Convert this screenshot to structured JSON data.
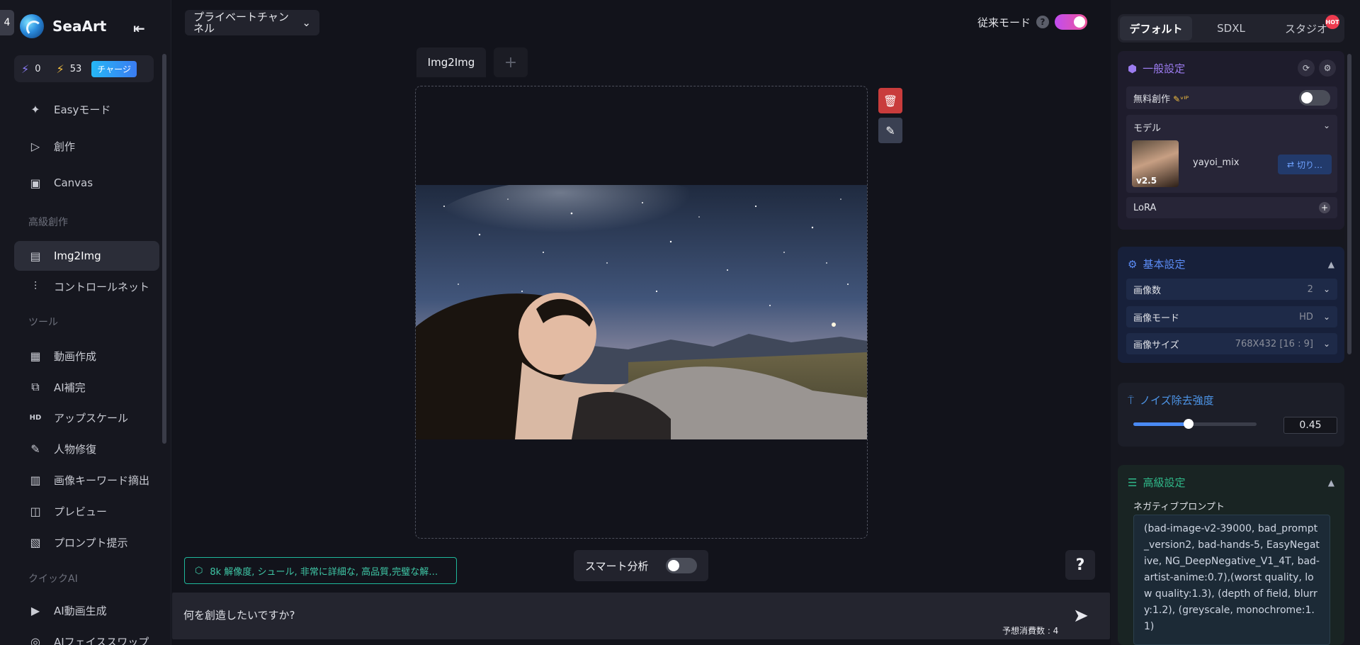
{
  "corner_badge": "4",
  "sidebar": {
    "app_name": "SeaArt",
    "credits": {
      "stamina": "0",
      "power": "53",
      "charge_label": "チャージ"
    },
    "items": [
      {
        "label": "Easyモード",
        "icon": "sparkle-icon"
      },
      {
        "label": "創作",
        "icon": "play-icon"
      },
      {
        "label": "Canvas",
        "icon": "canvas-icon"
      }
    ],
    "section_advanced": "高級創作",
    "advanced_items": [
      {
        "label": "Img2Img",
        "icon": "image-icon",
        "active": true
      },
      {
        "label": "コントロールネット",
        "icon": "sliders-icon"
      }
    ],
    "section_tools": "ツール",
    "tool_items": [
      {
        "label": "動画作成",
        "icon": "gif-icon"
      },
      {
        "label": "AI補完",
        "icon": "expand-icon"
      },
      {
        "label": "アップスケール",
        "icon": "hd-icon"
      },
      {
        "label": "人物修復",
        "icon": "repair-icon"
      },
      {
        "label": "画像キーワード摘出",
        "icon": "book-icon"
      },
      {
        "label": "プレビュー",
        "icon": "preview-icon"
      },
      {
        "label": "プロンプト提示",
        "icon": "prompt-icon"
      }
    ],
    "section_quick": "クイックAI",
    "quick_items": [
      {
        "label": "AI動画生成",
        "icon": "video-icon"
      },
      {
        "label": "AIフェイススワップ",
        "icon": "face-icon"
      }
    ]
  },
  "topbar": {
    "channel_label": "プライベートチャンネル",
    "legacy_mode_label": "従来モード",
    "legacy_mode_on": true
  },
  "workspace": {
    "tab_label": "Img2Img",
    "prompt_chip": "8k 解像度, シュール, 非常に詳細な, 高品質,完璧な解…",
    "smart_analysis_label": "スマート分析",
    "help_label": "?",
    "input_placeholder": "何を創造したいですか?",
    "cost_label": "予想消費数 : 4"
  },
  "right_panel": {
    "tabs": [
      {
        "label": "デフォルト",
        "active": true
      },
      {
        "label": "SDXL"
      },
      {
        "label": "スタジオ",
        "badge": "HOT"
      }
    ],
    "general": {
      "title": "一般設定",
      "free_create_label": "無料創作",
      "model_label": "モデル",
      "model_name": "yayoi_mix",
      "model_version": "v2.5",
      "switch_label": "切り…",
      "lora_label": "LoRA"
    },
    "basic": {
      "title": "基本設定",
      "image_count_label": "画像数",
      "image_count_value": "2",
      "image_mode_label": "画像モード",
      "image_mode_value": "HD",
      "image_size_label": "画像サイズ",
      "image_size_value": "768X432 [16 : 9]"
    },
    "noise": {
      "title": "ノイズ除去強度",
      "value": "0.45",
      "fraction": 0.45
    },
    "advanced": {
      "title": "高級設定",
      "negative_label": "ネガティブプロンプト",
      "negative_text": "(bad-image-v2-39000, bad_prompt_version2, bad-hands-5, EasyNegative, NG_DeepNegative_V1_4T, bad-artist-anime:0.7),(worst quality, low quality:1.3), (depth of field, blurry:1.2), (greyscale, monochrome:1.1)"
    }
  },
  "colors": {
    "accent_blue": "#4a8af4",
    "delete_red": "#c93c3c",
    "prompt_green": "#1fb89b"
  }
}
